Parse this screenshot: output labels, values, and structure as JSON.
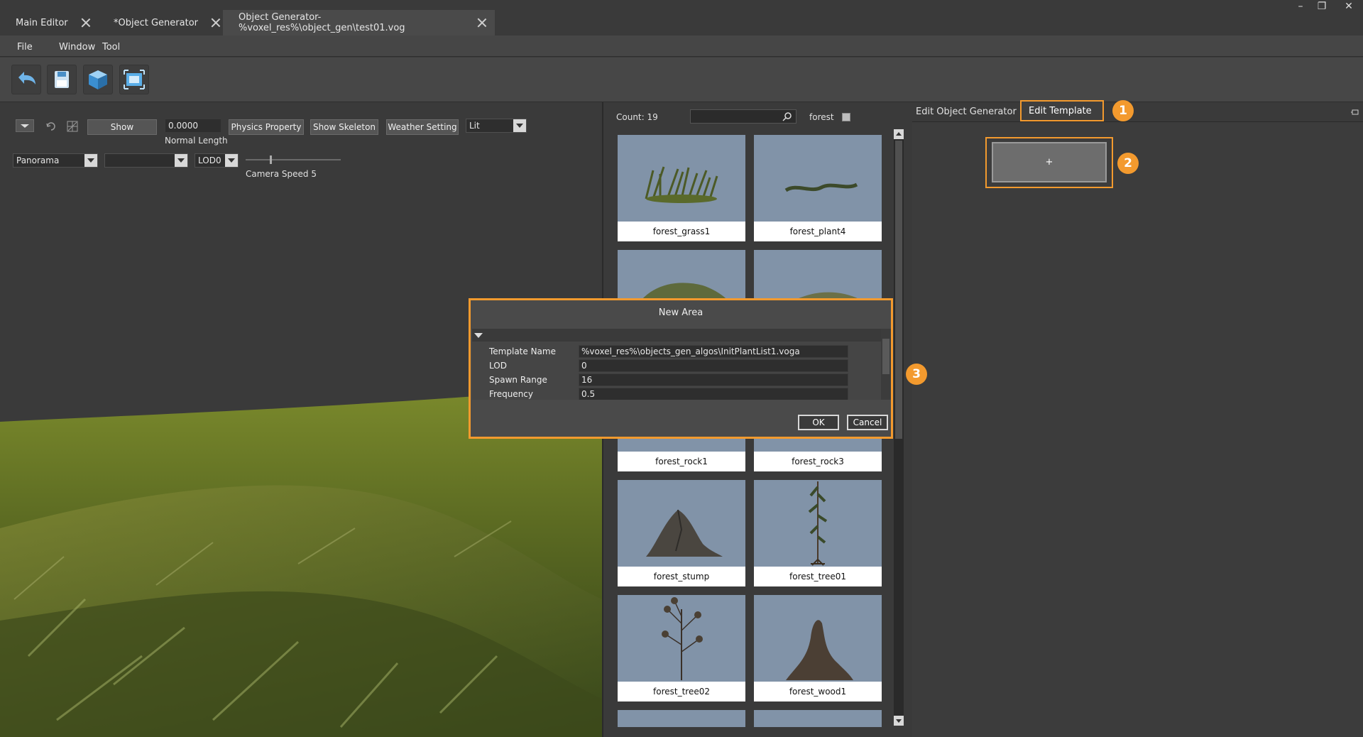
{
  "tabs": [
    {
      "label": "Main Editor"
    },
    {
      "label": "*Object Generator"
    },
    {
      "label": "Object Generator-%voxel_res%\\object_gen\\test01.vog"
    }
  ],
  "window_controls": {
    "minimize": "–",
    "restore": "❐",
    "close": "✕"
  },
  "menu": [
    "File",
    "Window",
    "Tool"
  ],
  "toolbar_icons": [
    "undo-icon",
    "save-icon",
    "cube-icon",
    "screenshot-icon"
  ],
  "viewport": {
    "show_label": "Show",
    "normal_length_value": "0.0000",
    "normal_length_label": "Normal Length",
    "physics_label": "Physics Property",
    "skeleton_label": "Show Skeleton",
    "weather_label": "Weather Setting",
    "lit_value": "Lit",
    "panorama_value": "Panorama",
    "empty_combo_value": "",
    "lod_value": "LOD0",
    "camera_speed_label": "Camera Speed 5"
  },
  "browser": {
    "count": "Count: 19",
    "search_value": "",
    "filter_label": "forest",
    "assets": [
      "forest_grass1",
      "forest_plant4",
      "",
      "",
      "forest_rock1",
      "forest_rock3",
      "forest_stump",
      "forest_tree01",
      "forest_tree02",
      "forest_wood1"
    ]
  },
  "right": {
    "tab_edit_generator": "Edit Object Generator",
    "tab_edit_template": "Edit Template",
    "add_button": "+",
    "badge1": "1",
    "badge2": "2",
    "badge3": "3"
  },
  "dialog": {
    "title": "New Area",
    "rows": [
      {
        "key": "Template Name",
        "value": "%voxel_res%\\objects_gen_algos\\InitPlantList1.voga"
      },
      {
        "key": "LOD",
        "value": "0"
      },
      {
        "key": "Spawn Range",
        "value": "16"
      },
      {
        "key": "Frequency",
        "value": "0.5"
      }
    ],
    "ok": "OK",
    "cancel": "Cancel"
  },
  "colors": {
    "accent": "#f39a2e",
    "card_bg": "#8193a8"
  }
}
